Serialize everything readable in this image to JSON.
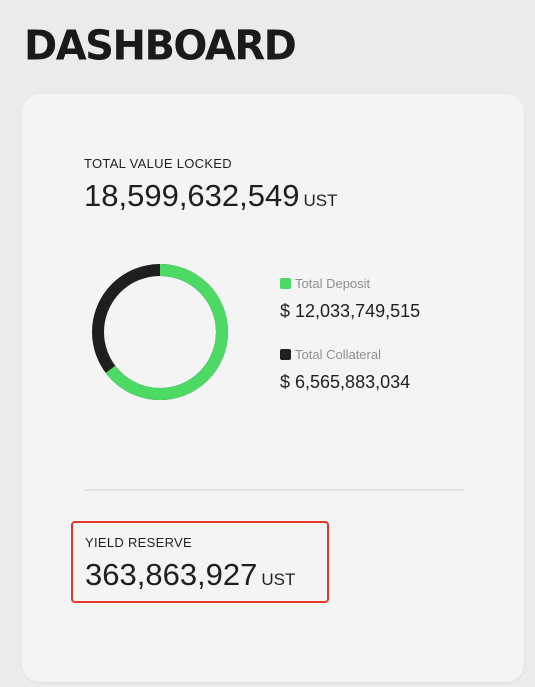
{
  "page": {
    "title": "DASHBOARD"
  },
  "tvl": {
    "label": "TOTAL VALUE LOCKED",
    "value": "18,599,632,549",
    "unit": "UST"
  },
  "chart": {
    "legend": [
      {
        "name": "Total Deposit",
        "value": "$ 12,033,749,515",
        "amount": 12033749515,
        "color": "#4cd964"
      },
      {
        "name": "Total Collateral",
        "value": "$ 6,565,883,034",
        "amount": 6565883034,
        "color": "#1f1f1f"
      }
    ]
  },
  "yield_reserve": {
    "label": "YIELD RESERVE",
    "value": "363,863,927",
    "unit": "UST"
  }
}
